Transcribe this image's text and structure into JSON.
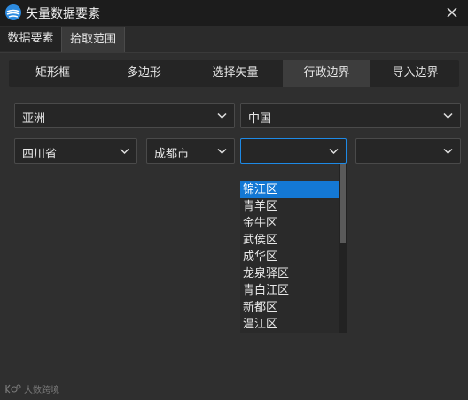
{
  "window": {
    "title": "矢量数据要素"
  },
  "top_tabs": [
    {
      "label": "数据要素"
    },
    {
      "label": "拾取范围"
    }
  ],
  "sub_tabs": [
    {
      "label": "矩形框"
    },
    {
      "label": "多边形"
    },
    {
      "label": "选择矢量"
    },
    {
      "label": "行政边界",
      "active": true
    },
    {
      "label": "导入边界"
    }
  ],
  "selects": {
    "continent": "亚洲",
    "country": "中国",
    "province": "四川省",
    "city": "成都市",
    "district": "",
    "subdistrict": ""
  },
  "district_options": [
    "锦江区",
    "青羊区",
    "金牛区",
    "武侯区",
    "成华区",
    "龙泉驿区",
    "青白江区",
    "新都区",
    "温江区"
  ],
  "district_selected_index": 0,
  "watermark": {
    "text": "大数跨境"
  },
  "colors": {
    "accent": "#1478d4",
    "background": "#2b2b2b"
  },
  "icons": {
    "app": "globe-logo-icon",
    "close": "close-icon",
    "select": "chevron-down-icon"
  }
}
